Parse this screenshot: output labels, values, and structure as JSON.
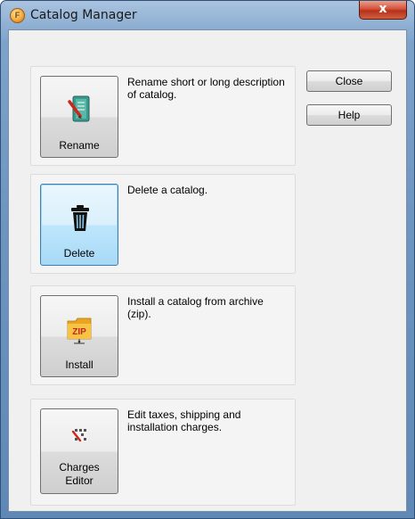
{
  "window": {
    "title": "Catalog Manager",
    "close_glyph": "x",
    "app_icon_glyph": "F"
  },
  "actions": [
    {
      "label": "Rename",
      "description": "Rename short or long description of catalog.",
      "icon": "notebook-pencil-icon"
    },
    {
      "label": "Delete",
      "description": "Delete a catalog.",
      "icon": "trash-can-icon"
    },
    {
      "label": "Install",
      "description": "Install a catalog from archive (zip).",
      "icon": "zip-folder-icon"
    },
    {
      "label_line1": "Charges",
      "label_line2": "Editor",
      "description": "Edit taxes, shipping and installation charges.",
      "icon": "charges-editor-icon"
    }
  ],
  "side_buttons": {
    "close_label": "Close",
    "help_label": "Help"
  },
  "colors": {
    "focus_border": "#3c7fb1",
    "zip_yellow": "#f2b531",
    "zip_red": "#c0281c"
  }
}
